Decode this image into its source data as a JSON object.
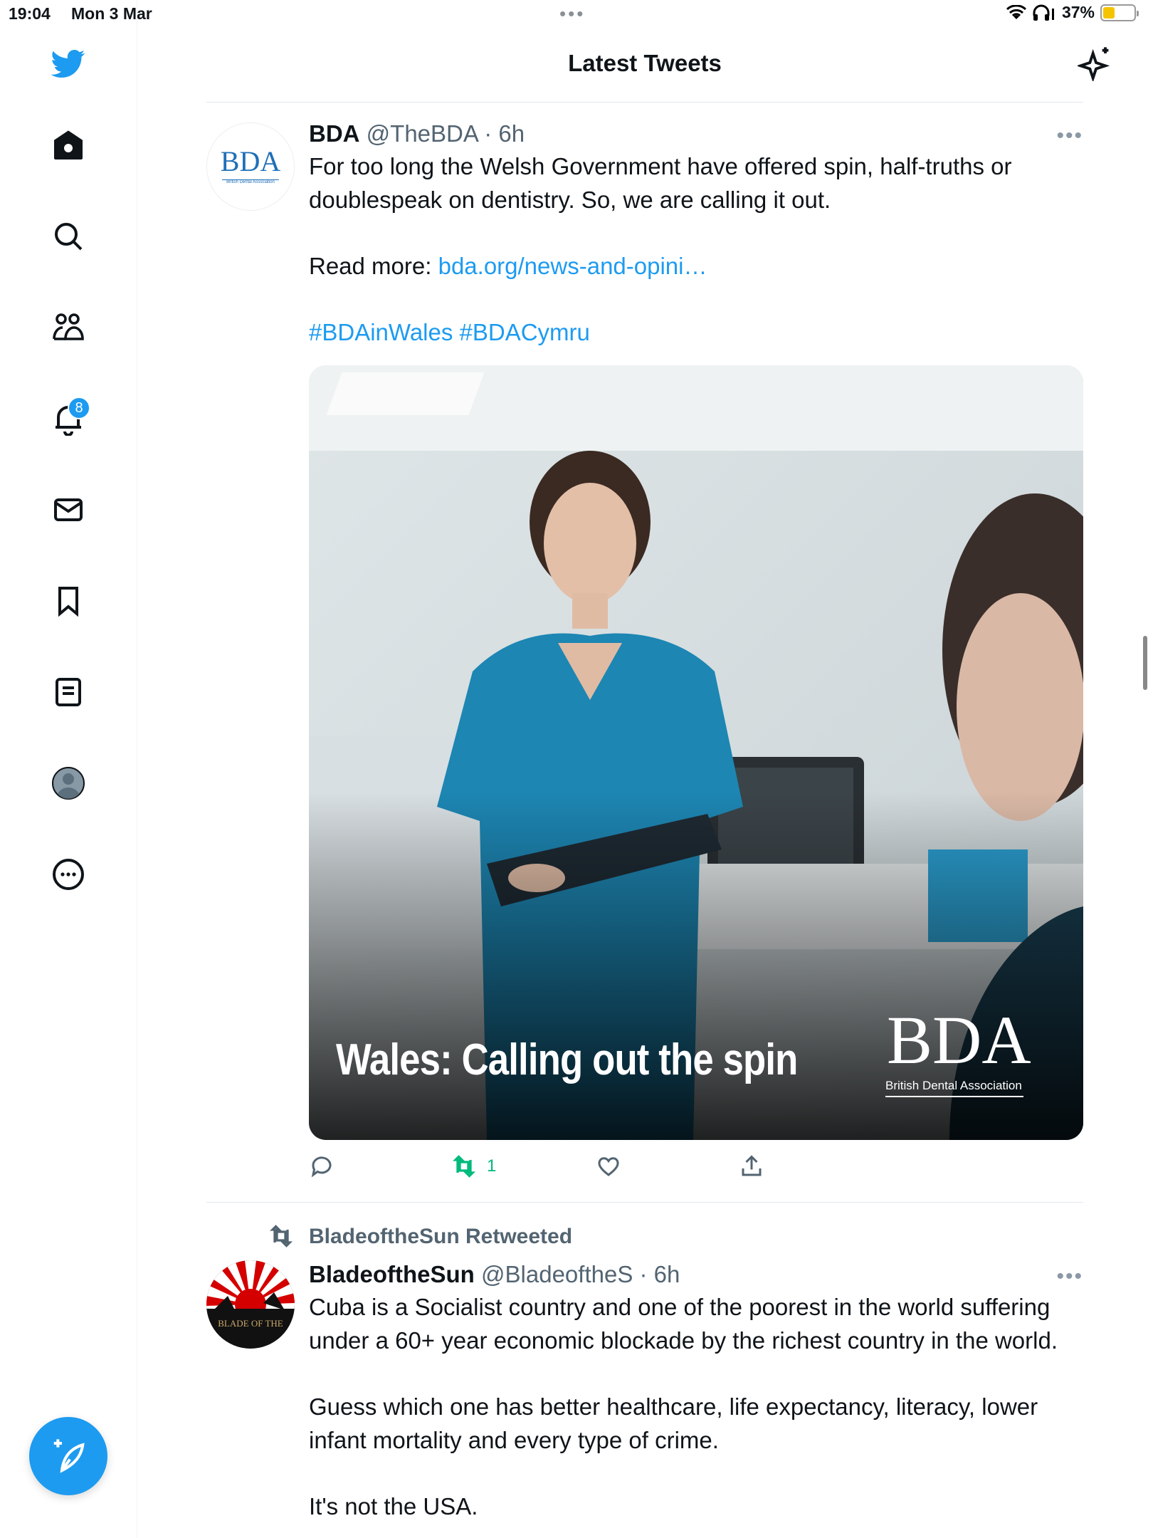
{
  "status_bar": {
    "time": "19:04",
    "date": "Mon 3 Mar",
    "battery": "37%"
  },
  "sidebar": {
    "notification_count": "8",
    "items": [
      "home-icon",
      "search-icon",
      "communities-icon",
      "notifications-icon",
      "messages-icon",
      "bookmarks-icon",
      "lists-icon",
      "profile-icon",
      "more-icon"
    ]
  },
  "header": {
    "title": "Latest Tweets"
  },
  "tweets": [
    {
      "name": "BDA",
      "handle": "@TheBDA",
      "time": "· 6h",
      "avatar_text": "BDA",
      "avatar_subtext": "British Dental Association",
      "text_1": "For too long the Welsh Government have offered spin, half-truths or doublespeak on dentistry. So, we are calling it out.",
      "read_more_label": "Read more: ",
      "link": "bda.org/news-and-opini…",
      "hashtags": "#BDAinWales #BDACymru",
      "image_caption": "Wales: Calling out the spin",
      "image_logo": "BDA",
      "image_logo_sub": "British Dental Association",
      "retweet_count": "1"
    },
    {
      "retweeted_by": "BladeoftheSun Retweeted",
      "name": "BladeoftheSun",
      "handle": "@BladeoftheS",
      "time": "· 6h",
      "avatar_text": "BLADE OF THE",
      "text_1": "Cuba is a Socialist country and one of the poorest in the world suffering under a 60+ year economic blockade by the richest country in the world.",
      "text_2": "Guess which one has better healthcare, life expectancy, literacy, lower infant mortality and every type of crime.",
      "text_3": "It's not the USA."
    }
  ],
  "colors": {
    "accent": "#1d9bf0",
    "retweet_green": "#00ba7c",
    "secondary_text": "#536471"
  }
}
